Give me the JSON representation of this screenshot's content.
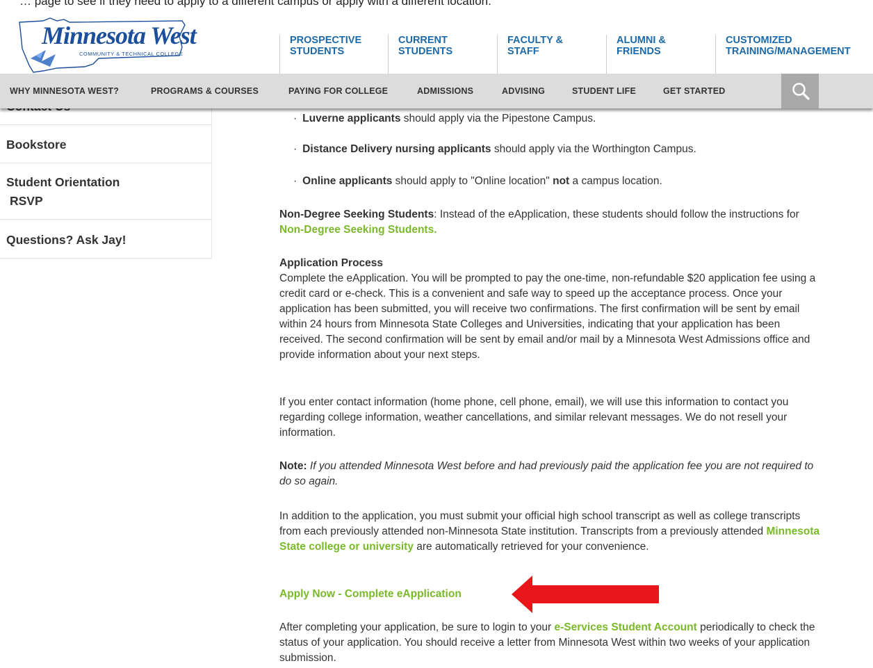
{
  "caption": "… page to see if they need to apply to a different campus or apply with a different location.",
  "logo": {
    "name": "Minnesota West",
    "subtitle": "COMMUNITY & TECHNICAL COLLEGE"
  },
  "top_nav": [
    {
      "line1": "PROSPECTIVE",
      "line2": "STUDENTS"
    },
    {
      "line1": "CURRENT",
      "line2": "STUDENTS"
    },
    {
      "line1": "FACULTY &",
      "line2": "STAFF"
    },
    {
      "line1": "ALUMNI &",
      "line2": "FRIENDS"
    },
    {
      "line1": "CUSTOMIZED",
      "line2": "TRAINING/MANAGEMENT"
    }
  ],
  "main_nav": [
    "WHY MINNESOTA WEST?",
    "PROGRAMS & COURSES",
    "PAYING FOR COLLEGE",
    "ADMISSIONS",
    "ADVISING",
    "STUDENT LIFE",
    "GET STARTED"
  ],
  "search_icon": "search-icon",
  "sidebar": [
    "Contact Us",
    "Bookstore",
    "Student Orientation",
    "RSVP",
    "Questions? Ask Jay!"
  ],
  "bullets": [
    {
      "bold": "Luverne applicants",
      "rest": " should apply via the Pipestone Campus."
    },
    {
      "bold": "Distance Delivery nursing applicants",
      "rest": " should apply via the Worthington Campus."
    },
    {
      "bold": "Online applicants",
      "rest_a": " should apply to \"Online location\" ",
      "bold2": "not",
      "rest_b": " a campus location."
    }
  ],
  "non_degree": {
    "label": "Non-Degree Seeking Students",
    "text": ": Instead of the eApplication, these students should follow the instructions for ",
    "link": "Non-Degree Seeking Students."
  },
  "app_process": {
    "heading": "Application Process",
    "body": "Complete the eApplication. You will be prompted to pay the one-time, non-refundable $20 application fee using a credit card or e-check. This is a convenient and safe way to speed up the acceptance process. Once your application has been submitted, you will receive two confirmations. The first confirmation will be sent by email within 24 hours from Minnesota State Colleges and Universities, indicating that your application has been received. The second confirmation will be sent by email and/or mail by a Minnesota West Admissions office and provide information about your next steps."
  },
  "contact_para": "If you enter contact information (home phone, cell phone, email), we will use this information to contact you regarding college information, weather cancellations, and similar relevant messages. We do not resell your information.",
  "note": {
    "label": "Note:",
    "text": " If you attended Minnesota West before and had previously paid the application fee you are not required to do so again."
  },
  "transcripts": {
    "text_a": "In addition to the application, you must submit your official high school transcript as well as college transcripts from each previously attended non-Minnesota State institution. Transcripts from a previously attended ",
    "link": "Minnesota State college or university",
    "text_b": " are automatically retrieved for your convenience."
  },
  "apply_now": "Apply Now - Complete eApplication",
  "after": {
    "text_a": "After completing your application, be sure to login to your ",
    "link": "e-Services Student Account",
    "text_b": " periodically to check the status of your application. You should receive a letter from Minnesota West within two weeks of your application submission."
  },
  "colors": {
    "brand_blue": "#1e6aa8",
    "link_green": "#7ab929",
    "nav_gray": "#dcdcdc",
    "arrow_red": "#e8161b"
  }
}
